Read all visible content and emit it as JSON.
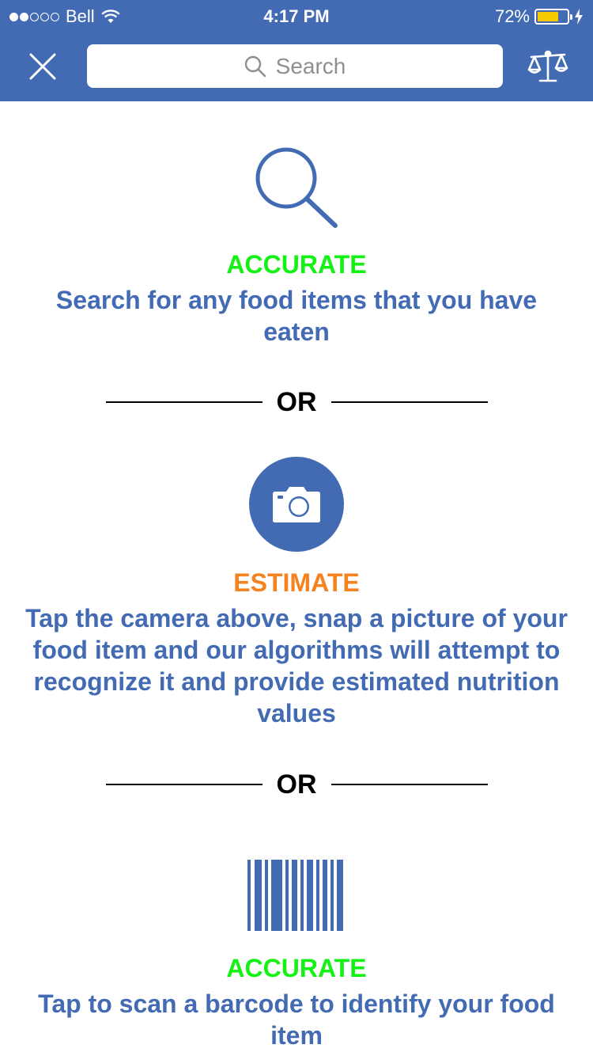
{
  "status_bar": {
    "carrier": "Bell",
    "time": "4:17 PM",
    "battery": "72%",
    "battery_level": 0.72
  },
  "header": {
    "search_placeholder": "Search",
    "close_icon": "close-icon",
    "scale_icon": "balance-scale-icon"
  },
  "options": [
    {
      "badge": "ACCURATE",
      "description": "Search for any food items that you have eaten",
      "icon": "magnifier-icon"
    },
    {
      "badge": "ESTIMATE",
      "description": "Tap the camera above, snap a picture of your food item and our algorithms will attempt to recognize it and provide estimated nutrition values",
      "icon": "camera-icon"
    },
    {
      "badge": "ACCURATE",
      "description": "Tap to scan a barcode to identify your food item",
      "icon": "barcode-icon"
    }
  ],
  "separator": "OR",
  "colors": {
    "brand_blue": "#436bb4",
    "accurate_green": "#14f114",
    "estimate_orange": "#f6821f"
  }
}
